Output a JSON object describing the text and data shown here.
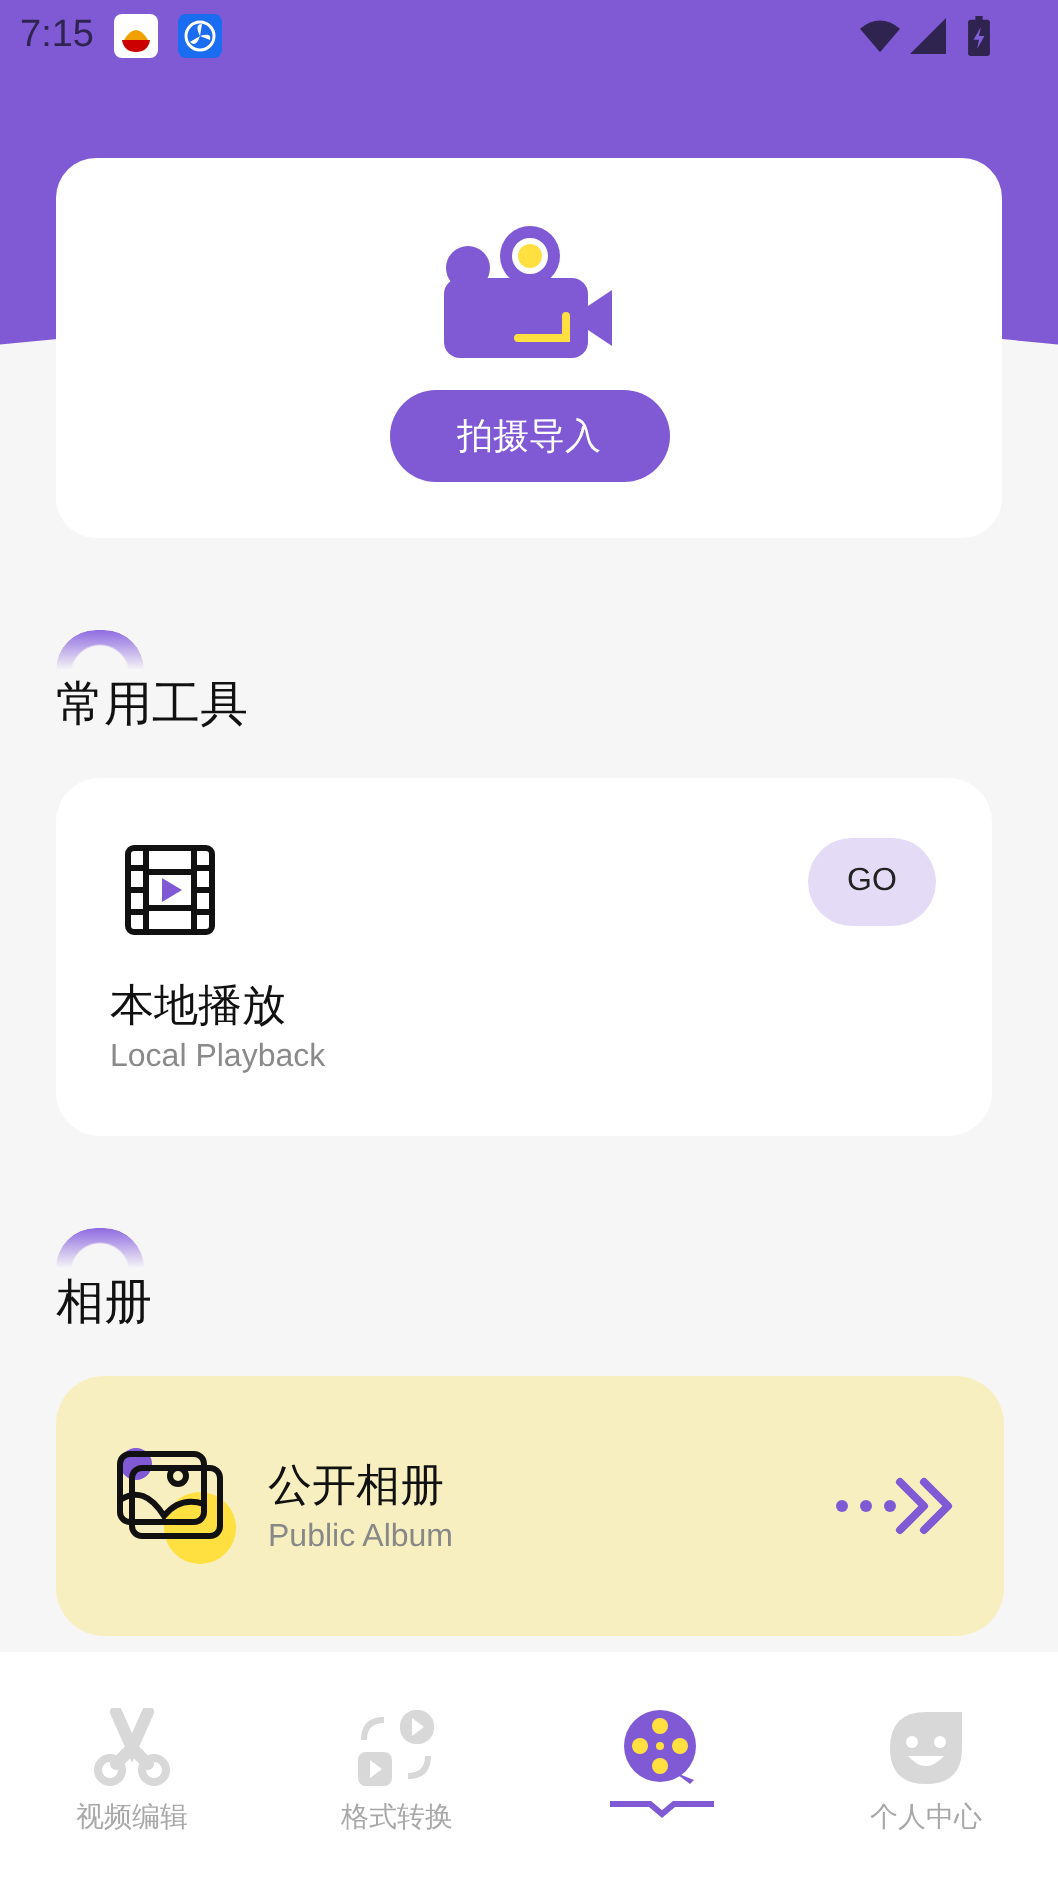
{
  "status_bar": {
    "time": "7:15"
  },
  "banner": {
    "button": "拍摄导入"
  },
  "tools_section": {
    "title": "常用工具",
    "card": {
      "title": "本地播放",
      "subtitle": "Local Playback",
      "button": "GO"
    }
  },
  "album_section": {
    "title": "相册",
    "card": {
      "title": "公开相册",
      "subtitle": "Public Album"
    }
  },
  "bottom_nav": [
    {
      "kind": "scissors",
      "label": "视频编辑",
      "selected": false
    },
    {
      "kind": "convert",
      "label": "格式转换",
      "selected": false
    },
    {
      "kind": "reel",
      "selected": true
    },
    {
      "kind": "face",
      "label": "个人中心",
      "selected": false
    }
  ]
}
